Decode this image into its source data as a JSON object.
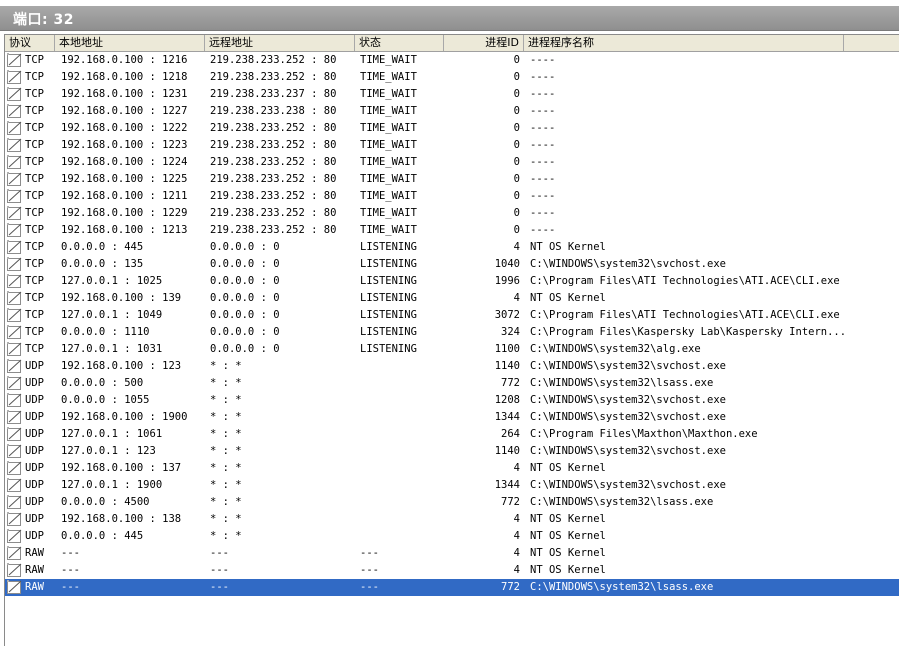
{
  "title": "端口: 32",
  "columns": {
    "protocol": "协议",
    "local": "本地地址",
    "remote": "远程地址",
    "state": "状态",
    "pid": "进程ID",
    "process": "进程程序名称"
  },
  "rows": [
    {
      "protocol": "TCP",
      "local": "192.168.0.100 : 1216",
      "remote": "219.238.233.252 : 80",
      "state": "TIME_WAIT",
      "pid": "0",
      "process": "----"
    },
    {
      "protocol": "TCP",
      "local": "192.168.0.100 : 1218",
      "remote": "219.238.233.252 : 80",
      "state": "TIME_WAIT",
      "pid": "0",
      "process": "----"
    },
    {
      "protocol": "TCP",
      "local": "192.168.0.100 : 1231",
      "remote": "219.238.233.237 : 80",
      "state": "TIME_WAIT",
      "pid": "0",
      "process": "----"
    },
    {
      "protocol": "TCP",
      "local": "192.168.0.100 : 1227",
      "remote": "219.238.233.238 : 80",
      "state": "TIME_WAIT",
      "pid": "0",
      "process": "----"
    },
    {
      "protocol": "TCP",
      "local": "192.168.0.100 : 1222",
      "remote": "219.238.233.252 : 80",
      "state": "TIME_WAIT",
      "pid": "0",
      "process": "----"
    },
    {
      "protocol": "TCP",
      "local": "192.168.0.100 : 1223",
      "remote": "219.238.233.252 : 80",
      "state": "TIME_WAIT",
      "pid": "0",
      "process": "----"
    },
    {
      "protocol": "TCP",
      "local": "192.168.0.100 : 1224",
      "remote": "219.238.233.252 : 80",
      "state": "TIME_WAIT",
      "pid": "0",
      "process": "----"
    },
    {
      "protocol": "TCP",
      "local": "192.168.0.100 : 1225",
      "remote": "219.238.233.252 : 80",
      "state": "TIME_WAIT",
      "pid": "0",
      "process": "----"
    },
    {
      "protocol": "TCP",
      "local": "192.168.0.100 : 1211",
      "remote": "219.238.233.252 : 80",
      "state": "TIME_WAIT",
      "pid": "0",
      "process": "----"
    },
    {
      "protocol": "TCP",
      "local": "192.168.0.100 : 1229",
      "remote": "219.238.233.252 : 80",
      "state": "TIME_WAIT",
      "pid": "0",
      "process": "----"
    },
    {
      "protocol": "TCP",
      "local": "192.168.0.100 : 1213",
      "remote": "219.238.233.252 : 80",
      "state": "TIME_WAIT",
      "pid": "0",
      "process": "----"
    },
    {
      "protocol": "TCP",
      "local": "0.0.0.0 : 445",
      "remote": "0.0.0.0 : 0",
      "state": "LISTENING",
      "pid": "4",
      "process": "NT OS Kernel"
    },
    {
      "protocol": "TCP",
      "local": "0.0.0.0 : 135",
      "remote": "0.0.0.0 : 0",
      "state": "LISTENING",
      "pid": "1040",
      "process": "C:\\WINDOWS\\system32\\svchost.exe"
    },
    {
      "protocol": "TCP",
      "local": "127.0.0.1 : 1025",
      "remote": "0.0.0.0 : 0",
      "state": "LISTENING",
      "pid": "1996",
      "process": "C:\\Program Files\\ATI Technologies\\ATI.ACE\\CLI.exe"
    },
    {
      "protocol": "TCP",
      "local": "192.168.0.100 : 139",
      "remote": "0.0.0.0 : 0",
      "state": "LISTENING",
      "pid": "4",
      "process": "NT OS Kernel"
    },
    {
      "protocol": "TCP",
      "local": "127.0.0.1 : 1049",
      "remote": "0.0.0.0 : 0",
      "state": "LISTENING",
      "pid": "3072",
      "process": "C:\\Program Files\\ATI Technologies\\ATI.ACE\\CLI.exe"
    },
    {
      "protocol": "TCP",
      "local": "0.0.0.0 : 1110",
      "remote": "0.0.0.0 : 0",
      "state": "LISTENING",
      "pid": "324",
      "process": "C:\\Program Files\\Kaspersky Lab\\Kaspersky Intern..."
    },
    {
      "protocol": "TCP",
      "local": "127.0.0.1 : 1031",
      "remote": "0.0.0.0 : 0",
      "state": "LISTENING",
      "pid": "1100",
      "process": "C:\\WINDOWS\\system32\\alg.exe"
    },
    {
      "protocol": "UDP",
      "local": "192.168.0.100 : 123",
      "remote": "* : *",
      "state": "",
      "pid": "1140",
      "process": "C:\\WINDOWS\\system32\\svchost.exe"
    },
    {
      "protocol": "UDP",
      "local": "0.0.0.0 : 500",
      "remote": "* : *",
      "state": "",
      "pid": "772",
      "process": "C:\\WINDOWS\\system32\\lsass.exe"
    },
    {
      "protocol": "UDP",
      "local": "0.0.0.0 : 1055",
      "remote": "* : *",
      "state": "",
      "pid": "1208",
      "process": "C:\\WINDOWS\\system32\\svchost.exe"
    },
    {
      "protocol": "UDP",
      "local": "192.168.0.100 : 1900",
      "remote": "* : *",
      "state": "",
      "pid": "1344",
      "process": "C:\\WINDOWS\\system32\\svchost.exe"
    },
    {
      "protocol": "UDP",
      "local": "127.0.0.1 : 1061",
      "remote": "* : *",
      "state": "",
      "pid": "264",
      "process": "C:\\Program Files\\Maxthon\\Maxthon.exe"
    },
    {
      "protocol": "UDP",
      "local": "127.0.0.1 : 123",
      "remote": "* : *",
      "state": "",
      "pid": "1140",
      "process": "C:\\WINDOWS\\system32\\svchost.exe"
    },
    {
      "protocol": "UDP",
      "local": "192.168.0.100 : 137",
      "remote": "* : *",
      "state": "",
      "pid": "4",
      "process": "NT OS Kernel"
    },
    {
      "protocol": "UDP",
      "local": "127.0.0.1 : 1900",
      "remote": "* : *",
      "state": "",
      "pid": "1344",
      "process": "C:\\WINDOWS\\system32\\svchost.exe"
    },
    {
      "protocol": "UDP",
      "local": "0.0.0.0 : 4500",
      "remote": "* : *",
      "state": "",
      "pid": "772",
      "process": "C:\\WINDOWS\\system32\\lsass.exe"
    },
    {
      "protocol": "UDP",
      "local": "192.168.0.100 : 138",
      "remote": "* : *",
      "state": "",
      "pid": "4",
      "process": "NT OS Kernel"
    },
    {
      "protocol": "UDP",
      "local": "0.0.0.0 : 445",
      "remote": "* : *",
      "state": "",
      "pid": "4",
      "process": "NT OS Kernel"
    },
    {
      "protocol": "RAW",
      "local": "---",
      "remote": "---",
      "state": "---",
      "pid": "4",
      "process": "NT OS Kernel"
    },
    {
      "protocol": "RAW",
      "local": "---",
      "remote": "---",
      "state": "---",
      "pid": "4",
      "process": "NT OS Kernel"
    },
    {
      "protocol": "RAW",
      "local": "---",
      "remote": "---",
      "state": "---",
      "pid": "772",
      "process": "C:\\WINDOWS\\system32\\lsass.exe",
      "selected": true
    }
  ],
  "colors": {
    "selection": "#316ac5",
    "title_bar": "#9c9c9c",
    "header": "#ece9d8"
  },
  "icons": {
    "row": "connection-icon"
  }
}
